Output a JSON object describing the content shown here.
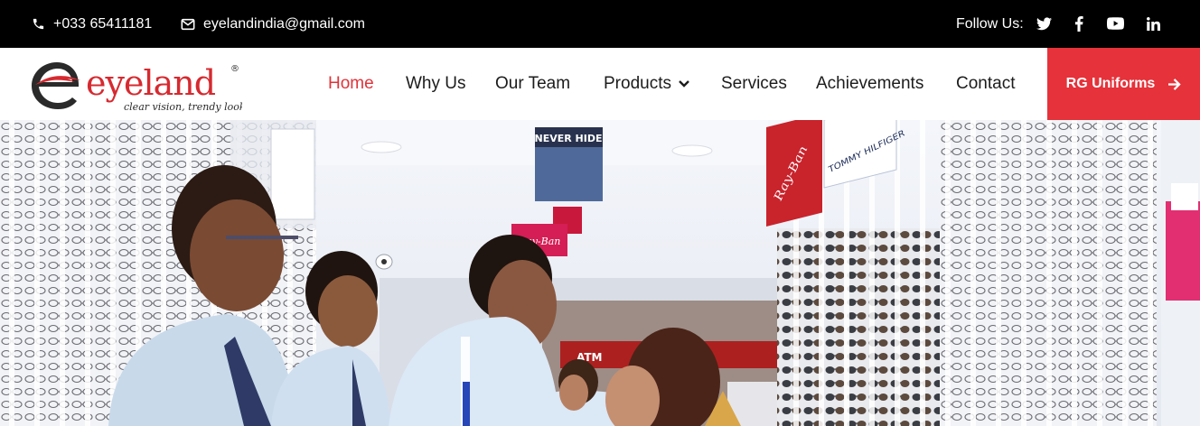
{
  "topbar": {
    "phone": "+033 65411181",
    "email": "eyelandindia@gmail.com",
    "follow_label": "Follow Us:",
    "social": [
      {
        "icon": "twitter-icon"
      },
      {
        "icon": "facebook-icon"
      },
      {
        "icon": "youtube-icon"
      },
      {
        "icon": "linkedin-icon"
      }
    ]
  },
  "logo": {
    "brand": "eyeland",
    "tagline": "clear vision, trendy look",
    "registered": "®",
    "colors": {
      "dark": "#2a2a2a",
      "red": "#d62a30"
    }
  },
  "nav": {
    "items": [
      {
        "label": "Home",
        "active": true
      },
      {
        "label": "Why Us"
      },
      {
        "label": "Our Team"
      },
      {
        "label": "Products",
        "has_dropdown": true
      },
      {
        "label": "Services"
      },
      {
        "label": "Achievements"
      },
      {
        "label": "Contact"
      }
    ],
    "cta_label": "RG Uniforms"
  },
  "hero": {
    "signs": {
      "never_hide": "NEVER HIDE",
      "rayban": "Ray-Ban",
      "tommy": "TOMMY HILFIGER",
      "atm": "ATM"
    }
  },
  "colors": {
    "accent": "#e6323a",
    "topbar": "#000000",
    "active_link": "#e1333a"
  }
}
